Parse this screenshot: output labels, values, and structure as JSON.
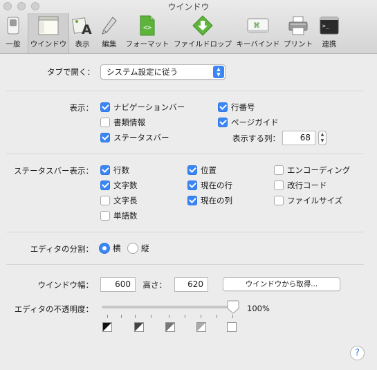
{
  "window": {
    "title": "ウインドウ"
  },
  "toolbar": {
    "items": [
      {
        "label": "一般",
        "icon": "switch-icon"
      },
      {
        "label": "ウインドウ",
        "icon": "window-icon",
        "active": true
      },
      {
        "label": "表示",
        "icon": "display-icon"
      },
      {
        "label": "編集",
        "icon": "pencil-icon"
      },
      {
        "label": "フォーマット",
        "icon": "format-file-icon"
      },
      {
        "label": "ファイルドロップ",
        "icon": "file-drop-icon"
      },
      {
        "label": "キーバインド",
        "icon": "keybinding-icon"
      },
      {
        "label": "プリント",
        "icon": "printer-icon"
      },
      {
        "label": "連携",
        "icon": "terminal-icon"
      }
    ]
  },
  "tabs": {
    "label": "タブで開く：",
    "value": "システム設定に従う"
  },
  "display": {
    "label": "表示：",
    "navigation_bar": {
      "label": "ナビゲーションバー",
      "checked": true
    },
    "document_info": {
      "label": "書類情報",
      "checked": false
    },
    "status_bar": {
      "label": "ステータスバー",
      "checked": true
    },
    "line_numbers": {
      "label": "行番号",
      "checked": true
    },
    "page_guide": {
      "label": "ページガイド",
      "checked": true
    },
    "columns_label": "表示する列：",
    "columns_value": "68"
  },
  "statusbar": {
    "label": "ステータスバー表示：",
    "lines": {
      "label": "行数",
      "checked": true
    },
    "chars": {
      "label": "文字数",
      "checked": true
    },
    "char_length": {
      "label": "文字長",
      "checked": false
    },
    "words": {
      "label": "単語数",
      "checked": false
    },
    "position": {
      "label": "位置",
      "checked": true
    },
    "current_line": {
      "label": "現在の行",
      "checked": true
    },
    "current_column": {
      "label": "現在の列",
      "checked": true
    },
    "encoding": {
      "label": "エンコーディング",
      "checked": false
    },
    "line_ending": {
      "label": "改行コード",
      "checked": false
    },
    "file_size": {
      "label": "ファイルサイズ",
      "checked": false
    }
  },
  "split": {
    "label": "エディタの分割：",
    "horizontal": "横",
    "vertical": "縦",
    "selected": "横"
  },
  "size": {
    "width_label": "ウインドウ幅：",
    "width_value": "600",
    "height_label": "高さ：",
    "height_value": "620",
    "get_button": "ウインドウから取得..."
  },
  "opacity": {
    "label": "エディタの不透明度：",
    "value_text": "100%",
    "value": 1.0
  },
  "colors": {
    "accent": "#3b86f5",
    "toolbar_bg": "#d4d4d4",
    "pane_bg": "#ececec"
  },
  "help": {
    "label": "?"
  }
}
